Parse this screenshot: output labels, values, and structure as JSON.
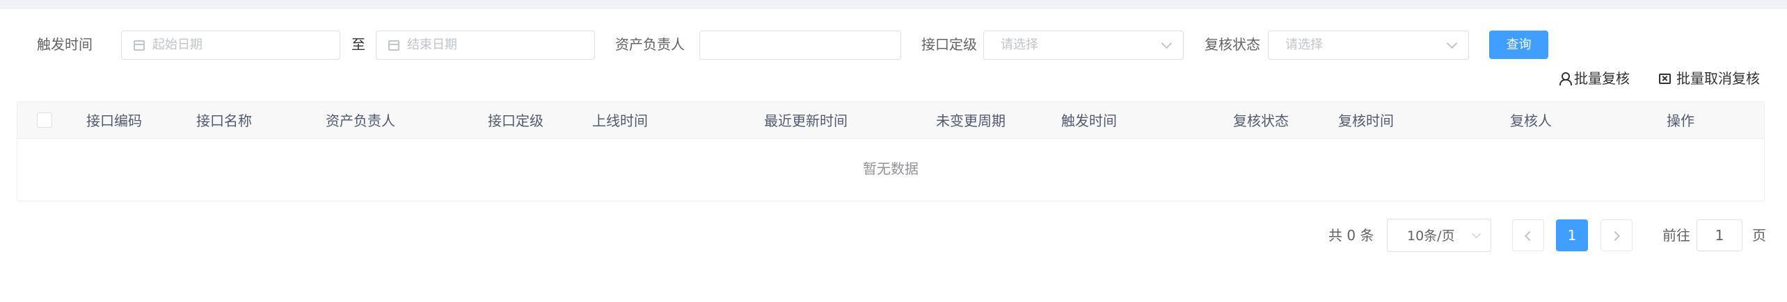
{
  "filters": {
    "trigger_time_label": "触发时间",
    "start_date_placeholder": "起始日期",
    "range_separator": "至",
    "end_date_placeholder": "结束日期",
    "owner_label": "资产负责人",
    "owner_value": "",
    "grade_label": "接口定级",
    "grade_placeholder": "请选择",
    "review_status_label": "复核状态",
    "review_status_placeholder": "请选择",
    "query_button": "查询"
  },
  "toolbar": {
    "batch_review": "批量复核",
    "batch_cancel_review": "批量取消复核"
  },
  "table": {
    "columns": [
      "接口编码",
      "接口名称",
      "资产负责人",
      "接口定级",
      "上线时间",
      "最近更新时间",
      "未变更周期",
      "触发时间",
      "复核状态",
      "复核时间",
      "复核人",
      "操作"
    ],
    "empty_text": "暂无数据"
  },
  "pagination": {
    "total": "共 0 条",
    "page_size": "10条/页",
    "current_page": "1",
    "goto_prefix": "前往",
    "goto_value": "1",
    "goto_suffix": "页"
  },
  "colors": {
    "primary": "#409eff",
    "border": "#dcdfe6",
    "placeholder": "#c0c4cc"
  }
}
